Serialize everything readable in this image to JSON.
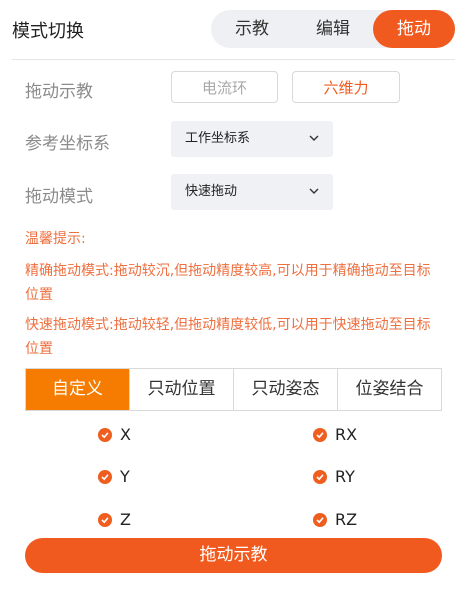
{
  "header": {
    "title": "模式切换",
    "modes": [
      "示教",
      "编辑",
      "拖动"
    ],
    "active_mode": "拖动"
  },
  "drag_teach": {
    "label": "拖动示教",
    "options": [
      "电流环",
      "六维力"
    ],
    "selected": "六维力"
  },
  "reference_frame": {
    "label": "参考坐标系",
    "value": "工作坐标系",
    "icon": "chevron-down-icon"
  },
  "drag_mode": {
    "label": "拖动模式",
    "value": "快速拖动",
    "icon": "chevron-down-icon"
  },
  "tips": {
    "title": "温馨提示:",
    "precise": "精确拖动模式:拖动较沉,但拖动精度较高,可以用于精确拖动至目标位置",
    "fast": "快速拖动模式:拖动较轻,但拖动精度较低,可以用于快速拖动至目标位置"
  },
  "constraint_tabs": {
    "items": [
      "自定义",
      "只动位置",
      "只动姿态",
      "位姿结合"
    ],
    "active": "自定义"
  },
  "axes": {
    "left": [
      "X",
      "Y",
      "Z"
    ],
    "right": [
      "RX",
      "RY",
      "RZ"
    ],
    "all_checked": true
  },
  "action": {
    "label": "拖动示教"
  },
  "colors": {
    "accent": "#f15a1f",
    "tab_active": "#f57c00",
    "hint_text": "#ee6f3f"
  }
}
